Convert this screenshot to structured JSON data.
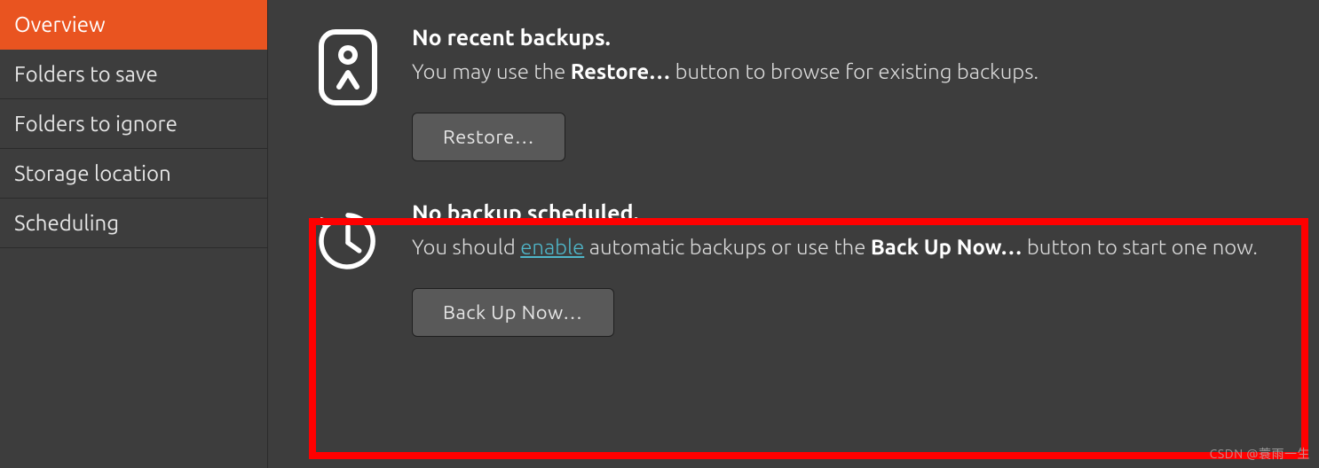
{
  "sidebar": {
    "items": [
      {
        "label": "Overview",
        "active": true
      },
      {
        "label": "Folders to save",
        "active": false
      },
      {
        "label": "Folders to ignore",
        "active": false
      },
      {
        "label": "Storage location",
        "active": false
      },
      {
        "label": "Scheduling",
        "active": false
      }
    ]
  },
  "sections": {
    "restore": {
      "heading": "No recent backups.",
      "desc_pre": "You may use the ",
      "desc_bold": "Restore…",
      "desc_post": " button to browse for existing backups.",
      "button": "Restore…"
    },
    "backup": {
      "heading": "No backup scheduled.",
      "desc_pre": "You should ",
      "desc_link": "enable",
      "desc_mid": " automatic backups or use the ",
      "desc_bold": "Back Up Now…",
      "desc_post": " button to start one now.",
      "button": "Back Up Now…"
    }
  },
  "watermark": "CSDN @蓑雨一生"
}
